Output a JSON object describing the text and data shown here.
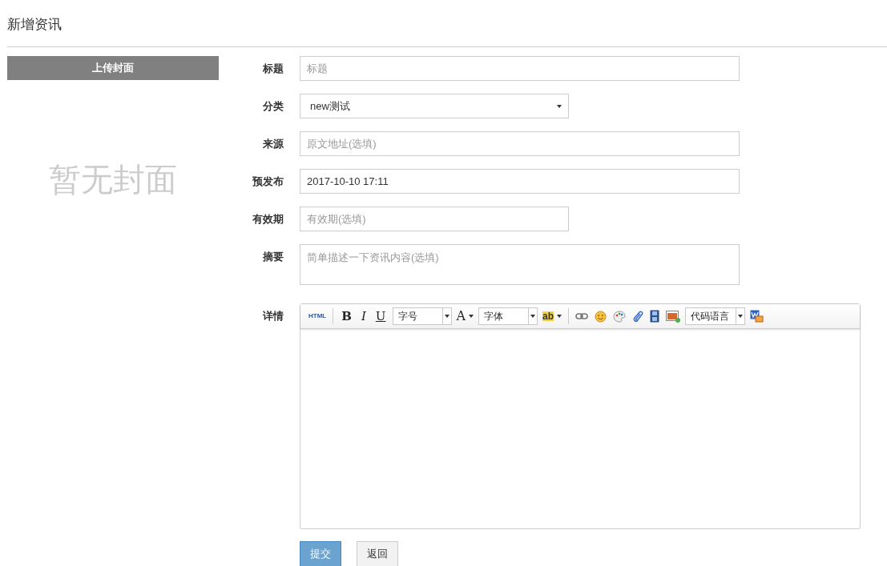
{
  "page_title": "新增资讯",
  "cover": {
    "upload_button": "上传封面",
    "empty_text": "暂无封面"
  },
  "fields": [
    {
      "kind": "input",
      "label": "标题",
      "placeholder": "标题"
    },
    {
      "kind": "select",
      "label": "分类",
      "value": "new测试"
    },
    {
      "kind": "input",
      "label": "来源",
      "placeholder": "原文地址(选填)"
    },
    {
      "kind": "input",
      "label": "预发布",
      "value": "2017-10-10 17:11"
    },
    {
      "kind": "input",
      "label": "有效期",
      "placeholder": "有效期(选填)"
    },
    {
      "kind": "textarea",
      "label": "摘要",
      "placeholder": "简单描述一下资讯内容(选填)"
    }
  ],
  "editor": {
    "label": "详情",
    "toolbar": [
      {
        "kind": "html",
        "label": "HTML"
      },
      {
        "kind": "sep"
      },
      {
        "kind": "bold",
        "label": "B"
      },
      {
        "kind": "italic",
        "label": "I"
      },
      {
        "kind": "underline",
        "label": "U"
      },
      {
        "kind": "combo",
        "label": "字号"
      },
      {
        "kind": "fontcolor",
        "label": "A"
      },
      {
        "kind": "combo",
        "label": "字体"
      },
      {
        "kind": "highlight",
        "label": "ab"
      },
      {
        "kind": "sep"
      },
      {
        "kind": "link"
      },
      {
        "kind": "smiley"
      },
      {
        "kind": "palette"
      },
      {
        "kind": "paperclip"
      },
      {
        "kind": "film"
      },
      {
        "kind": "image"
      },
      {
        "kind": "combo",
        "label": "代码语言"
      },
      {
        "kind": "word"
      }
    ]
  },
  "buttons": [
    {
      "kind": "primary",
      "label": "提交"
    },
    {
      "kind": "default",
      "label": "返回"
    }
  ]
}
